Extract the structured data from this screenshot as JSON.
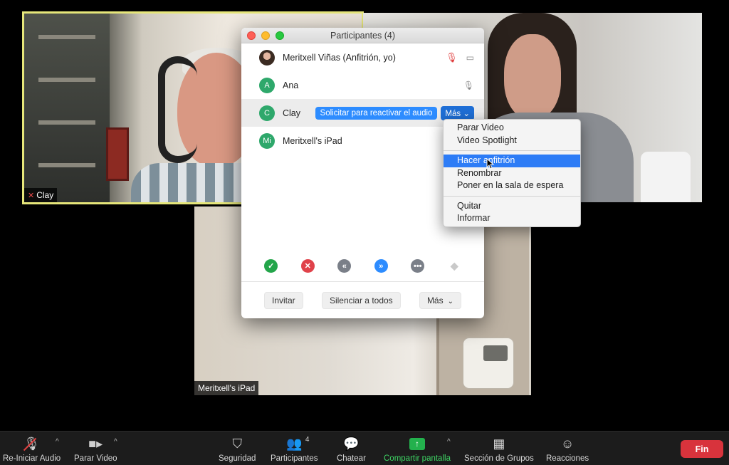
{
  "videos": {
    "clay": {
      "name": "Clay"
    },
    "ipad": {
      "name": "Meritxell's iPad"
    }
  },
  "participants_window": {
    "title": "Participantes (4)",
    "participants": [
      {
        "initials": "",
        "name": "Meritxell Viñas (Anfitrión, yo)"
      },
      {
        "initials": "A",
        "name": "Ana"
      },
      {
        "initials": "C",
        "name": "Clay",
        "request_label": "Solicitar para reactivar el audio",
        "more_label": "Más"
      },
      {
        "initials": "Mi",
        "name": "Meritxell's iPad"
      }
    ],
    "reactions": [
      "yes-icon",
      "no-icon",
      "slower-icon",
      "faster-icon",
      "more-icon",
      "clear-icon"
    ],
    "footer": {
      "invite": "Invitar",
      "mute_all": "Silenciar a todos",
      "more": "Más"
    }
  },
  "context_menu": {
    "group1": [
      "Parar Video",
      "Video Spotlight"
    ],
    "group2": [
      "Hacer anfitrión",
      "Renombrar",
      "Poner en la sala de espera"
    ],
    "group3": [
      "Quitar",
      "Informar"
    ],
    "active_item": "Hacer anfitrión"
  },
  "toolbar": {
    "audio": "Re-Iniciar Audio",
    "video": "Parar Video",
    "security": "Seguridad",
    "participants": "Participantes",
    "participants_count": "4",
    "chat": "Chatear",
    "share": "Compartir pantalla",
    "breakout": "Sección de Grupos",
    "reactions": "Reacciones",
    "end": "Fin"
  },
  "colors": {
    "accent_blue": "#2d8cff",
    "end_red": "#d8333c",
    "share_green": "#3ed464",
    "active_speaker_border": "#e6e67a"
  }
}
